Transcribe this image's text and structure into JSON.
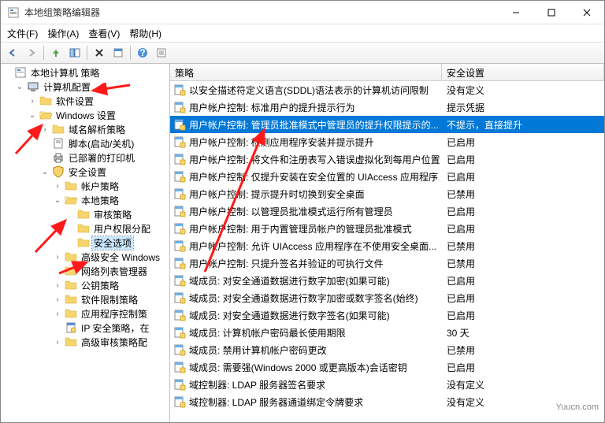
{
  "window": {
    "title": "本地组策略编辑器"
  },
  "menubar": {
    "file": "文件(F)",
    "action": "操作(A)",
    "view": "查看(V)",
    "help": "帮助(H)"
  },
  "tree": {
    "root": "本地计算机 策略",
    "computerConfig": "计算机配置",
    "softwareSettings": "软件设置",
    "windowsSettings": "Windows 设置",
    "nameResolution": "域名解析策略",
    "scripts": "脚本(启动/关机)",
    "printers": "已部署的打印机",
    "securitySettings": "安全设置",
    "accountPolicy": "帐户策略",
    "localPolicy": "本地策略",
    "auditPolicy": "审核策略",
    "userRights": "用户权限分配",
    "securityOptions": "安全选项",
    "advancedSecurity": "高级安全 Windows",
    "networkListMgr": "网络列表管理器",
    "publicKey": "公钥策略",
    "softwareRestriction": "软件限制策略",
    "appControl": "应用程序控制策",
    "ipSecurity": "IP 安全策略，在",
    "advancedAudit": "高级审核策略配"
  },
  "listHeader": {
    "policy": "策略",
    "setting": "安全设置"
  },
  "policies": [
    {
      "name": "以安全描述符定义语言(SDDL)语法表示的计算机访问限制",
      "setting": "没有定义"
    },
    {
      "name": "用户帐户控制: 标准用户的提升提示行为",
      "setting": "提示凭据"
    },
    {
      "name": "用户帐户控制: 管理员批准模式中管理员的提升权限提示的...",
      "setting": "不提示，直接提升",
      "selected": true
    },
    {
      "name": "用户帐户控制: 检测应用程序安装并提示提升",
      "setting": "已启用"
    },
    {
      "name": "用户帐户控制: 将文件和注册表写入错误虚拟化到每用户位置",
      "setting": "已启用"
    },
    {
      "name": "用户帐户控制: 仅提升安装在安全位置的 UIAccess 应用程序",
      "setting": "已启用"
    },
    {
      "name": "用户帐户控制: 提示提升时切换到安全桌面",
      "setting": "已禁用"
    },
    {
      "name": "用户帐户控制: 以管理员批准模式运行所有管理员",
      "setting": "已启用"
    },
    {
      "name": "用户帐户控制: 用于内置管理员帐户的管理员批准模式",
      "setting": "已启用"
    },
    {
      "name": "用户帐户控制: 允许 UIAccess 应用程序在不使用安全桌面...",
      "setting": "已禁用"
    },
    {
      "name": "用户帐户控制: 只提升签名并验证的可执行文件",
      "setting": "已禁用"
    },
    {
      "name": "域成员: 对安全通道数据进行数字加密(如果可能)",
      "setting": "已启用"
    },
    {
      "name": "域成员: 对安全通道数据进行数字加密或数字签名(始终)",
      "setting": "已启用"
    },
    {
      "name": "域成员: 对安全通道数据进行数字签名(如果可能)",
      "setting": "已启用"
    },
    {
      "name": "域成员: 计算机帐户密码最长使用期限",
      "setting": "30 天"
    },
    {
      "name": "域成员: 禁用计算机帐户密码更改",
      "setting": "已禁用"
    },
    {
      "name": "域成员: 需要强(Windows 2000 或更高版本)会话密钥",
      "setting": "已启用"
    },
    {
      "name": "域控制器: LDAP 服务器签名要求",
      "setting": "没有定义"
    },
    {
      "name": "域控制器: LDAP 服务器通道绑定令牌要求",
      "setting": "没有定义"
    }
  ],
  "watermark": "Yuucn.com"
}
